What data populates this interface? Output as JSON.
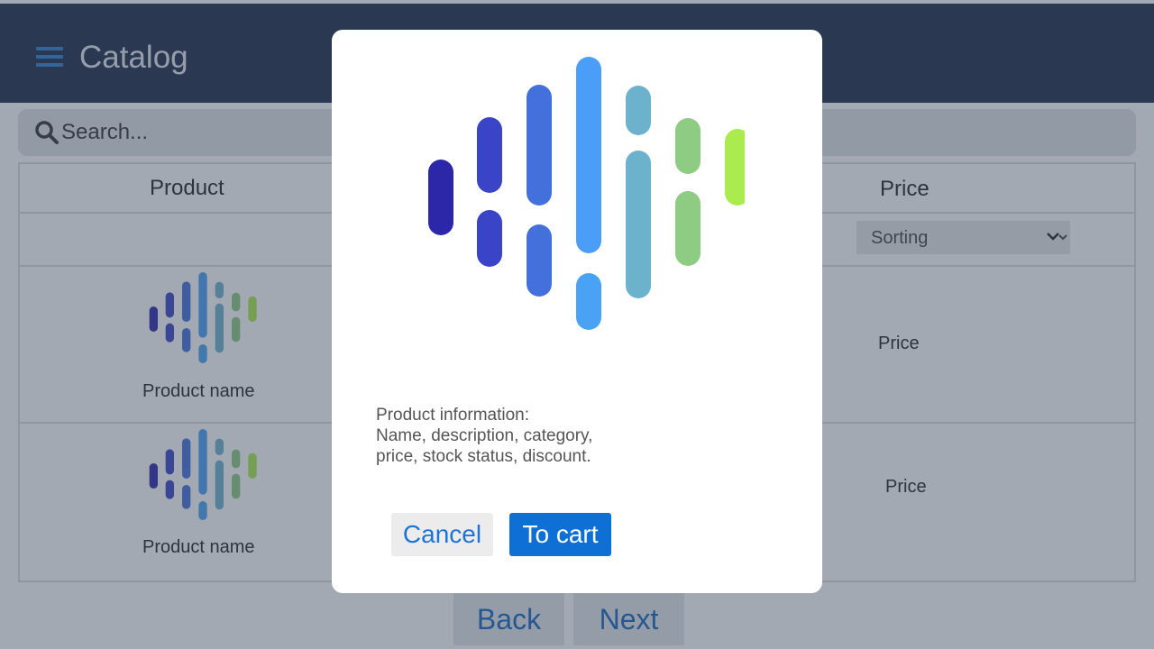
{
  "app": {
    "title": "Catalog"
  },
  "search": {
    "placeholder": "Search..."
  },
  "table": {
    "headers": {
      "product": "Product",
      "price": "Price"
    },
    "sort_select": {
      "selected": "Sorting"
    },
    "rows": [
      {
        "product_name": "Product name",
        "price": "Price"
      },
      {
        "product_name": "Product name",
        "price": "Price"
      }
    ]
  },
  "pagination": {
    "back_label": "Back",
    "next_label": "Next"
  },
  "modal": {
    "info_lines": [
      "Product information:",
      "Name, description, category,",
      "price, stock status, discount."
    ],
    "cancel_label": "Cancel",
    "cart_label": "To cart"
  },
  "colors": {
    "header_bg": "#1e2b4a",
    "accent": "#0e6fd4",
    "logo_gradient": [
      "#2b27a8",
      "#3a4fd0",
      "#4a9ef7",
      "#6ab7c8",
      "#8ecb83",
      "#aaec4e"
    ]
  },
  "icons": {
    "menu": "menu-icon",
    "search": "search-icon",
    "chevron": "chevron-down-icon",
    "logo": "product-logo"
  }
}
